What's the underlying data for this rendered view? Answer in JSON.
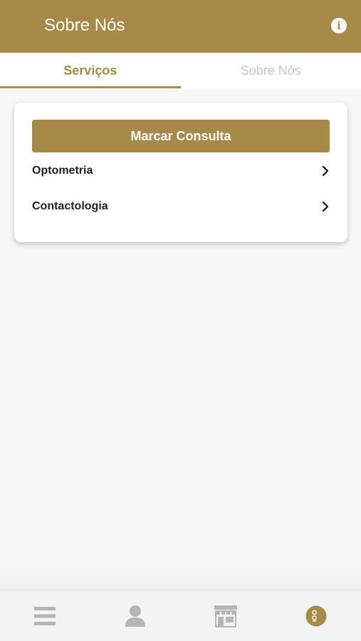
{
  "header": {
    "title": "Sobre Nós",
    "info_icon": "info-icon"
  },
  "tabs": [
    {
      "label": "Serviços",
      "active": true
    },
    {
      "label": "Sobre Nós",
      "active": false
    }
  ],
  "card": {
    "book_button_label": "Marcar Consulta",
    "items": [
      {
        "label": "Optometria",
        "icon": "chevron-right-icon"
      },
      {
        "label": "Contactologia",
        "icon": "chevron-right-icon"
      }
    ]
  },
  "tabbar": {
    "items": [
      {
        "icon": "menu-icon",
        "active": false
      },
      {
        "icon": "user-icon",
        "active": false
      },
      {
        "icon": "store-icon",
        "active": false
      },
      {
        "icon": "about-icon",
        "active": true
      }
    ]
  },
  "colors": {
    "accent": "#a88a48",
    "inactive_icon": "#b5b5b5",
    "inactive_tab_text": "#c9c9c9"
  }
}
